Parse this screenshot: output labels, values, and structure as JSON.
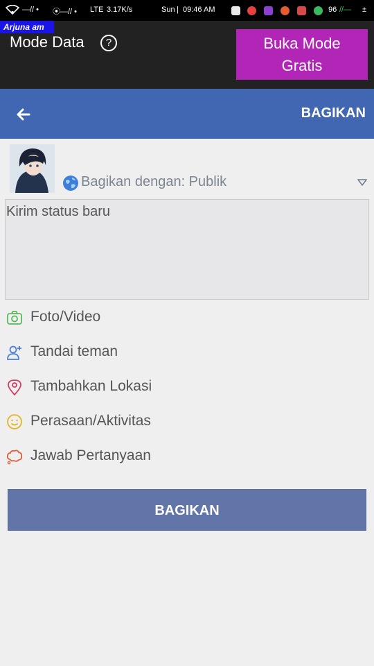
{
  "status_bar": {
    "left_text": "LTE",
    "speed": "3.17K/s",
    "day": "Sun",
    "time": "09:46 AM",
    "battery": "96"
  },
  "watermark": "Arjuna am",
  "data_mode": {
    "title": "Mode Data",
    "help_label": "?",
    "free_button": "Buka Mode Gratis"
  },
  "header": {
    "share_label": "BAGIKAN"
  },
  "composer": {
    "privacy_label": "Bagikan dengan: Publik",
    "placeholder": "Kirim status baru"
  },
  "options": [
    {
      "label": "Foto/Video",
      "color": "#5cb85c"
    },
    {
      "label": "Tandai teman",
      "color": "#4a7fd6"
    },
    {
      "label": "Tambahkan Lokasi",
      "color": "#d63a64"
    },
    {
      "label": "Perasaan/Aktivitas",
      "color": "#e6b527"
    },
    {
      "label": "Jawab Pertanyaan",
      "color": "#e0613a"
    }
  ],
  "share_button": "BAGIKAN",
  "colors": {
    "header_blue": "#4267b2",
    "free_button": "#b125b7",
    "share_button": "#6175a8"
  }
}
